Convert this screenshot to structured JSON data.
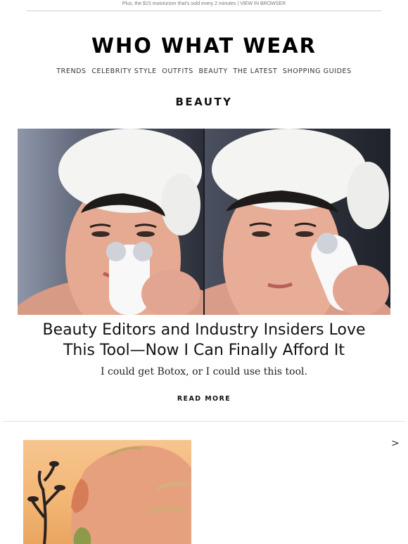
{
  "preheader": {
    "text": "Plus, the $15 moisturizer that's sold every 2 minutes | ",
    "link": "VIEW IN BROWSER"
  },
  "logo": {
    "text": "WHO WHAT WEAR"
  },
  "nav": {
    "items": [
      "TRENDS",
      "CELEBRITY STYLE",
      "OUTFITS",
      "BEAUTY",
      "THE LATEST",
      "SHOPPING GUIDES"
    ]
  },
  "section": {
    "label": "BEAUTY"
  },
  "article": {
    "headline_line1": "Beauty Editors and Industry Insiders Love",
    "headline_line2": "This Tool—Now I Can Finally Afford It",
    "dek": "I could get Botox, or I could use this tool.",
    "cta": "READ MORE"
  },
  "next_article": {
    "arrow": ">"
  },
  "colors": {
    "text": "#111111",
    "nav": "#333333",
    "divider": "#e2e2e2",
    "thumb_bg": "#f3b574"
  }
}
